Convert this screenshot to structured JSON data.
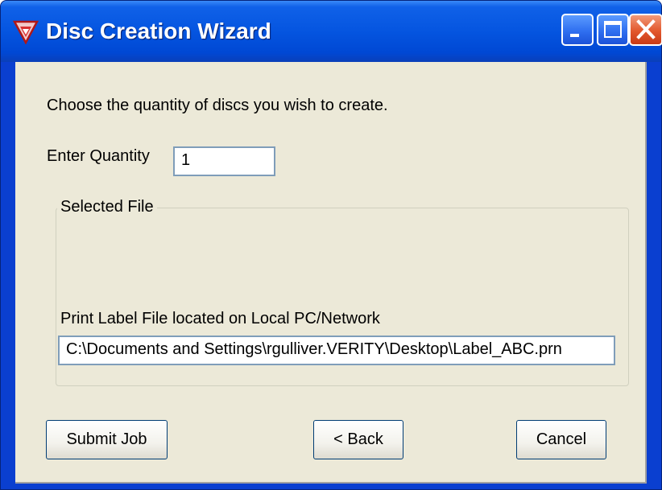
{
  "window": {
    "title": "Disc Creation Wizard",
    "app_icon": "wizard-app-icon",
    "controls": [
      "minimize-icon",
      "maximize-icon",
      "close-icon"
    ],
    "accent": "#0055e5"
  },
  "main": {
    "instruction": "Choose the quantity of discs you wish to create.",
    "quantity_label": "Enter Quantity",
    "quantity_value": "1",
    "group_title": "Selected File",
    "file_label": "Print Label File located on Local PC/Network",
    "file_path": "C:\\Documents and Settings\\rgulliver.VERITY\\Desktop\\Label_ABC.prn"
  },
  "buttons": {
    "submit": "Submit Job",
    "back": "< Back",
    "cancel": "Cancel"
  }
}
